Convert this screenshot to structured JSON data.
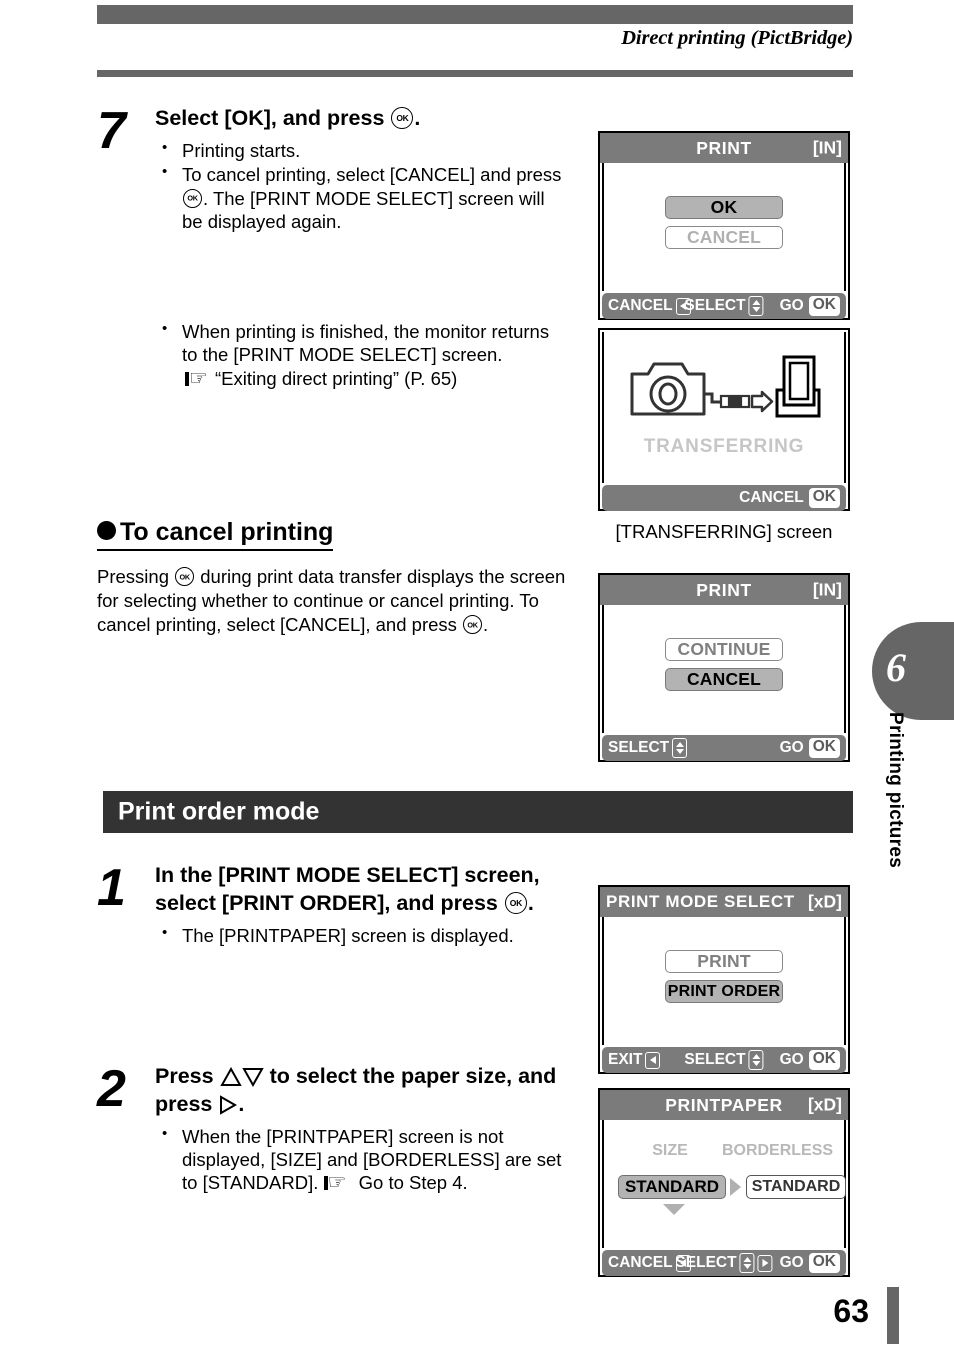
{
  "header": {
    "title": "Direct printing (PictBridge)"
  },
  "step7": {
    "number": "7",
    "heading_pre": "Select [OK], and press",
    "heading_post": ".",
    "bullets": [
      {
        "pre": "Printing starts."
      },
      {
        "pre": "To cancel printing, select [CANCEL] and press",
        "post": ". The [PRINT MODE SELECT] screen will be displayed again."
      },
      {
        "pre": "When printing is finished, the monitor returns to the [PRINT MODE SELECT] screen.",
        "ref": "“Exiting direct printing” (P. 65)"
      }
    ]
  },
  "cancel_section": {
    "title": "To cancel printing",
    "body_1": "Pressing",
    "body_2": "during print data transfer displays the screen for selecting whether to continue or cancel printing. To cancel printing, select [CANCEL], and press",
    "body_3": "."
  },
  "section": {
    "title": "Print order mode"
  },
  "step1": {
    "number": "1",
    "heading_pre": "In the [PRINT MODE SELECT] screen, select [PRINT ORDER], and press",
    "heading_post": ".",
    "bullets": [
      {
        "pre": "The [PRINTPAPER] screen is displayed."
      }
    ]
  },
  "step2": {
    "number": "2",
    "heading_pre": "Press",
    "heading_mid": "to select the paper size, and press",
    "heading_post": ".",
    "bullets": [
      {
        "pre": "When the [PRINTPAPER] screen is not displayed, [SIZE] and [BORDERLESS] are set to [STANDARD].",
        "post": "Go to Step 4."
      }
    ]
  },
  "screens": [
    {
      "id": "print-ok-cancel",
      "title": "PRINT",
      "card": "[IN]",
      "buttons": [
        {
          "label": "OK",
          "state": "selected"
        },
        {
          "label": "CANCEL",
          "state": "unselected"
        }
      ],
      "footer": {
        "left": "CANCEL",
        "left_key": "left-arrow-key",
        "mid": "SELECT",
        "mid_key": "up-down-key",
        "right": "GO",
        "right_key": "OK"
      }
    },
    {
      "id": "transferring",
      "status": "TRANSFERRING",
      "icon": "camera-to-printer-transfer-icon",
      "footer": {
        "right": "CANCEL",
        "right_key": "OK"
      },
      "caption": "[TRANSFERRING] screen"
    },
    {
      "id": "print-continue-cancel",
      "title": "PRINT",
      "card": "[IN]",
      "buttons": [
        {
          "label": "CONTINUE",
          "state": "unselected"
        },
        {
          "label": "CANCEL",
          "state": "selected"
        }
      ],
      "footer": {
        "left": "SELECT",
        "left_key": "up-down-key",
        "right": "GO",
        "right_key": "OK"
      }
    },
    {
      "id": "print-mode-select",
      "title": "PRINT MODE SELECT",
      "card": "[xD]",
      "buttons": [
        {
          "label": "PRINT",
          "state": "unselected"
        },
        {
          "label": "PRINT ORDER",
          "state": "selected"
        }
      ],
      "footer": {
        "left": "EXIT",
        "left_key": "left-arrow-key",
        "mid": "SELECT",
        "mid_key": "up-down-key",
        "right": "GO",
        "right_key": "OK"
      }
    },
    {
      "id": "printpaper",
      "title": "PRINTPAPER",
      "card": "[xD]",
      "col_labels": {
        "size": "SIZE",
        "borderless": "BORDERLESS"
      },
      "values": {
        "size": "STANDARD",
        "borderless": "STANDARD"
      },
      "footer": {
        "left": "CANCEL",
        "left_key": "left-arrow-key",
        "mid": "SELECT",
        "mid_key": "up-down-right-key",
        "right": "GO",
        "right_key": "OK"
      }
    }
  ],
  "chapter": {
    "number": "6",
    "label": "Printing pictures"
  },
  "footer": {
    "page_number": "63"
  },
  "colors": {
    "rule_gray": "#666666",
    "section_dark": "#333333",
    "lcd_bar": "#7b7b7b",
    "lcd_selected": "#b3b3b3"
  }
}
